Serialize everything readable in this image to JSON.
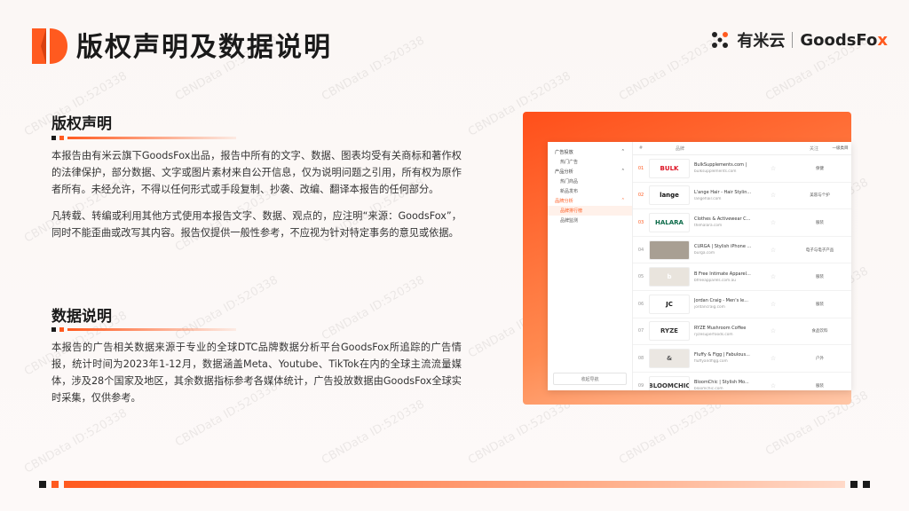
{
  "header": {
    "title": "版权声明及数据说明",
    "brand_cn": "有米云",
    "brand_en_main": "GoodsFo",
    "brand_en_accent": "x"
  },
  "copyright": {
    "heading": "版权声明",
    "para1": "本报告由有米云旗下GoodsFox出品，报告中所有的文字、数据、图表均受有关商标和著作权的法律保护，部分数据、文字或图片素材来自公开信息，仅为说明问题之引用，所有权为原作者所有。未经允许，不得以任何形式或手段复制、抄袭、改编、翻译本报告的任何部分。",
    "para2": "凡转载、转编或利用其他方式使用本报告文字、数据、观点的，应注明“来源：GoodsFox”，同时不能歪曲或改写其内容。报告仅提供一般性参考，不应视为针对特定事务的意见或依据。"
  },
  "data_note": {
    "heading": "数据说明",
    "para": "本报告的广告相关数据来源于专业的全球DTC品牌数据分析平台GoodsFox所追踪的广告情报，统计时间为2023年1-12月，数据涵盖Meta、Youtube、TikTok在内的全球主流流量媒体，涉及28个国家及地区，其余数据指标参考各媒体统计，广告投放数据由GoodsFox全球实时采集，仅供参考。"
  },
  "screenshot": {
    "sidebar": [
      {
        "type": "group",
        "label": "广告投放",
        "active": false
      },
      {
        "type": "item",
        "label": "热门广告",
        "active": false
      },
      {
        "type": "group",
        "label": "产品分析",
        "active": false
      },
      {
        "type": "item",
        "label": "热门商品",
        "active": false
      },
      {
        "type": "item",
        "label": "新品发布",
        "active": false
      },
      {
        "type": "group",
        "label": "品牌分析",
        "active": true
      },
      {
        "type": "item",
        "label": "品牌排行榜",
        "active": true
      },
      {
        "type": "item",
        "label": "品牌监测",
        "active": false
      }
    ],
    "sidebar_footer": "收起导航",
    "columns": {
      "rank": "#",
      "name": "品牌",
      "star": "关注",
      "cat": "一级类目"
    },
    "rows": [
      {
        "rank": "01",
        "logo": "BULK",
        "logo_bg": "#fff",
        "logo_color": "#d12",
        "name": "BulkSupplements.com |",
        "url": "bulksupplements.com",
        "cat": "保健"
      },
      {
        "rank": "02",
        "logo": "lange",
        "logo_bg": "#fff",
        "logo_color": "#111",
        "name": "L'ange Hair - Hair Stylin...",
        "url": "langehair.com",
        "cat": "美容与个护"
      },
      {
        "rank": "03",
        "logo": "HALARA",
        "logo_bg": "#fff",
        "logo_color": "#0d6b4a",
        "name": "Clothes & Activewear C...",
        "url": "thehalara.com",
        "cat": "服装"
      },
      {
        "rank": "04",
        "logo": "",
        "logo_bg": "#a89f93",
        "logo_color": "#fff",
        "name": "CURGA | Stylish iPhone ...",
        "url": "burga.com",
        "cat": "电子与电子产品"
      },
      {
        "rank": "05",
        "logo": "b",
        "logo_bg": "#e9e4dd",
        "logo_color": "#fff",
        "name": "B Free Intimate Apparel...",
        "url": "bfreeapparels.com.au",
        "cat": "服装"
      },
      {
        "rank": "06",
        "logo": "JC",
        "logo_bg": "#fff",
        "logo_color": "#111",
        "name": "Jordan Craig - Men's le...",
        "url": "jordancraig.com",
        "cat": "服装"
      },
      {
        "rank": "07",
        "logo": "RYZE",
        "logo_bg": "#fff",
        "logo_color": "#333",
        "name": "RYZE Mushroom Coffee",
        "url": "ryzesuperfoods.com",
        "cat": "食品饮料"
      },
      {
        "rank": "08",
        "logo": "&",
        "logo_bg": "#ebe7e2",
        "logo_color": "#555",
        "name": "Fluffy & Figg | Fabulous...",
        "url": "fluffyandfigg.com",
        "cat": "户外"
      },
      {
        "rank": "09",
        "logo": "BLOOMCHIC",
        "logo_bg": "#fff",
        "logo_color": "#333",
        "name": "BloomChic | Stylish Mo...",
        "url": "bloomchic.com",
        "cat": "服装"
      }
    ]
  },
  "watermark": "CBNData ID:520338",
  "colors": {
    "accent": "#ff5a1f",
    "dark": "#1a1a1a"
  }
}
